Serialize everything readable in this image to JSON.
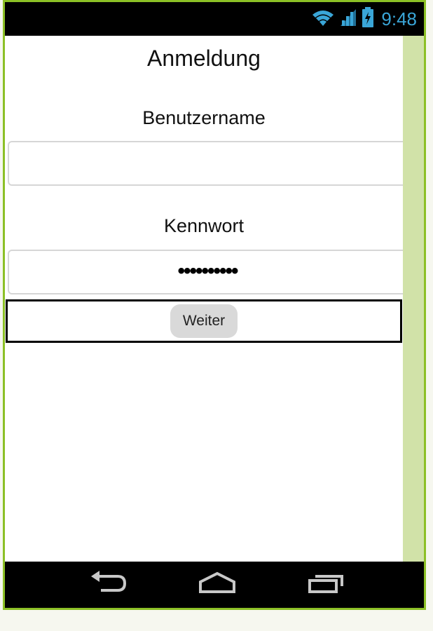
{
  "statusbar": {
    "time": "9:48",
    "icons": [
      "wifi-icon",
      "signal-icon",
      "battery-charging-icon"
    ],
    "accent_color": "#3aa6d8"
  },
  "screen": {
    "title": "Anmeldung",
    "username_label": "Benutzername",
    "username_value": "",
    "password_label": "Kennwort",
    "password_mask": "••••••••••",
    "continue_button": "Weiter"
  },
  "navbar": {
    "icons": [
      "back-icon",
      "home-icon",
      "recent-apps-icon"
    ]
  },
  "colors": {
    "frame": "#8cc026",
    "scroll_strip": "#d1e2a8",
    "button_bg": "#d9d9d9"
  }
}
